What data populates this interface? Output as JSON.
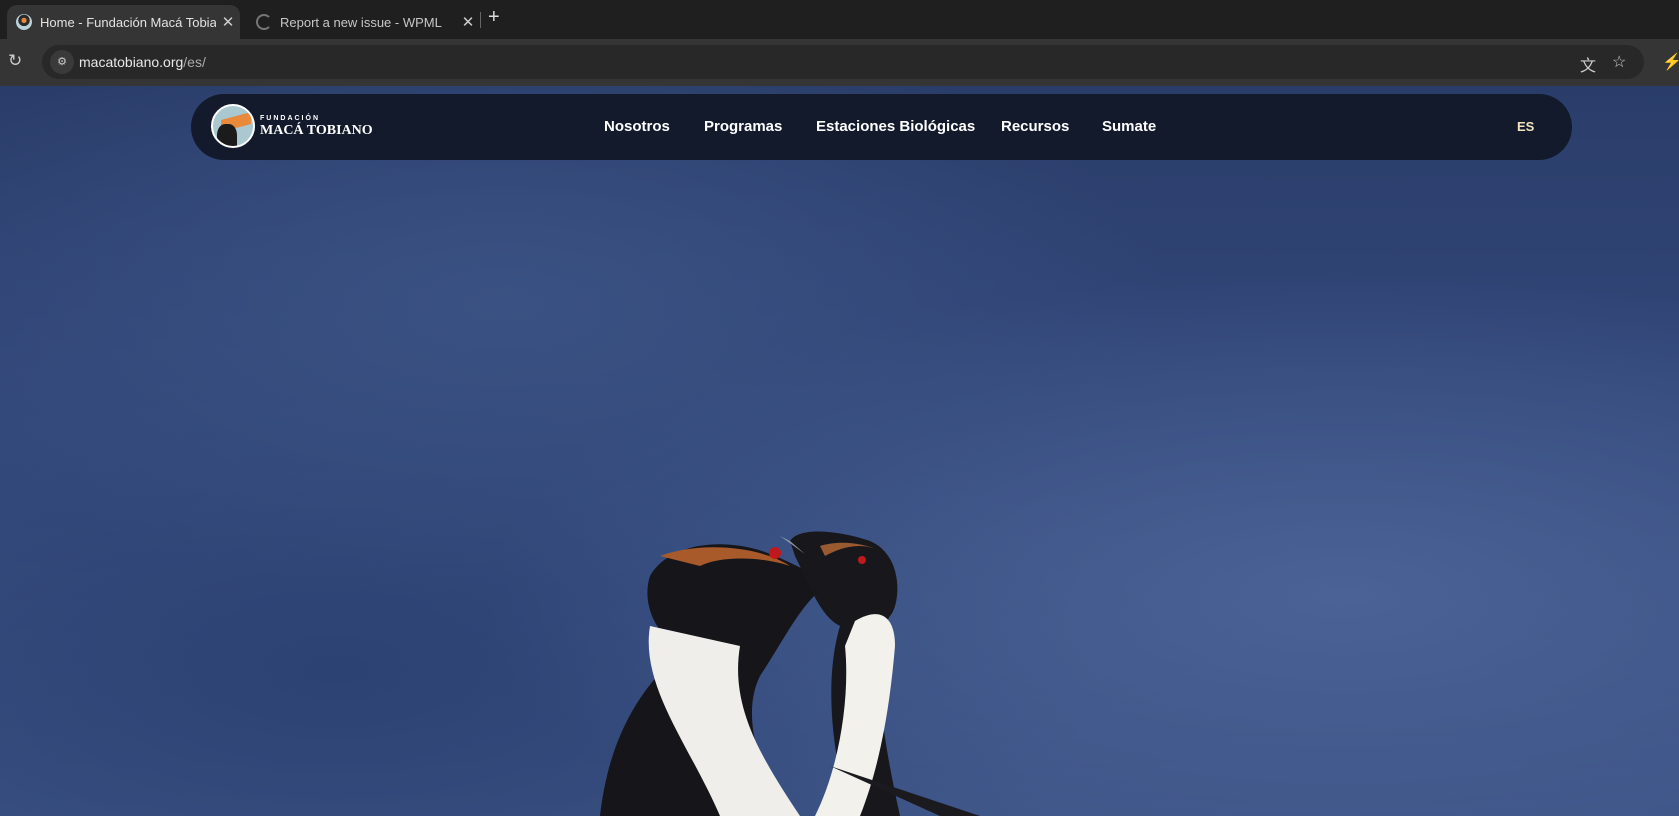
{
  "browser": {
    "tabs": [
      {
        "title": "Home - Fundación Macá Tobiano",
        "active": true
      },
      {
        "title": "Report a new issue - WPML",
        "active": false
      }
    ],
    "url_host": "macatobiano.org",
    "url_path": "/es/"
  },
  "site": {
    "logo": {
      "line1": "FUNDACIÓN",
      "line2": "MACÁ TOBIANO"
    },
    "nav": [
      "Nosotros",
      "Programas",
      "Estaciones Biológicas",
      "Recursos",
      "Sumate"
    ],
    "language": "ES"
  }
}
